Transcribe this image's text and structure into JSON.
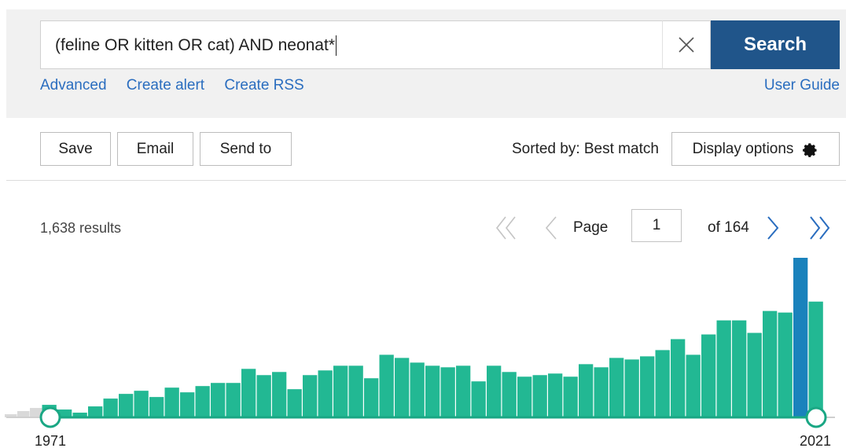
{
  "search": {
    "query": "(feline OR kitten OR cat) AND neonat*",
    "button_label": "Search"
  },
  "links": {
    "advanced": "Advanced",
    "create_alert": "Create alert",
    "create_rss": "Create RSS",
    "user_guide": "User Guide"
  },
  "toolbar": {
    "save_label": "Save",
    "email_label": "Email",
    "send_to_label": "Send to",
    "sorted_by": "Sorted by: Best match",
    "display_options_label": "Display options"
  },
  "icons": {
    "clear": "close-icon",
    "display_options": "gear-icon",
    "first": "double-chevron-left-icon",
    "prev": "chevron-left-icon",
    "next": "chevron-right-icon",
    "last": "double-chevron-right-icon"
  },
  "results": {
    "count_text": "1,638 results"
  },
  "pagination": {
    "page_label": "Page",
    "current_page": "1",
    "of_text": "of 164"
  },
  "colors": {
    "search_button": "#20558a",
    "link": "#2a6dbf",
    "bar": "#22b893",
    "bar_outside_range": "#d9d9d9",
    "bar_highlight": "#1a82bc",
    "slider_line": "#1aa784"
  },
  "chart_data": {
    "type": "bar",
    "title": "",
    "xlabel": "",
    "ylabel": "",
    "range_start_label": "1971",
    "range_end_label": "2021",
    "pre_range_values": [
      2,
      4,
      6
    ],
    "x": [
      1971,
      1972,
      1973,
      1974,
      1975,
      1976,
      1977,
      1978,
      1979,
      1980,
      1981,
      1982,
      1983,
      1984,
      1985,
      1986,
      1987,
      1988,
      1989,
      1990,
      1991,
      1992,
      1993,
      1994,
      1995,
      1996,
      1997,
      1998,
      1999,
      2000,
      2001,
      2002,
      2003,
      2004,
      2005,
      2006,
      2007,
      2008,
      2009,
      2010,
      2011,
      2012,
      2013,
      2014,
      2015,
      2016,
      2017,
      2018,
      2019,
      2020,
      2021
    ],
    "values": [
      8,
      5,
      3,
      7,
      12,
      15,
      17,
      13,
      19,
      16,
      20,
      22,
      22,
      31,
      27,
      29,
      18,
      27,
      30,
      33,
      33,
      25,
      40,
      38,
      35,
      33,
      32,
      33,
      23,
      33,
      29,
      26,
      27,
      28,
      26,
      34,
      32,
      38,
      37,
      39,
      43,
      50,
      40,
      53,
      62,
      62,
      54,
      68,
      67,
      102,
      74
    ],
    "highlight_year": 2020,
    "ylim": [
      0,
      102
    ]
  }
}
